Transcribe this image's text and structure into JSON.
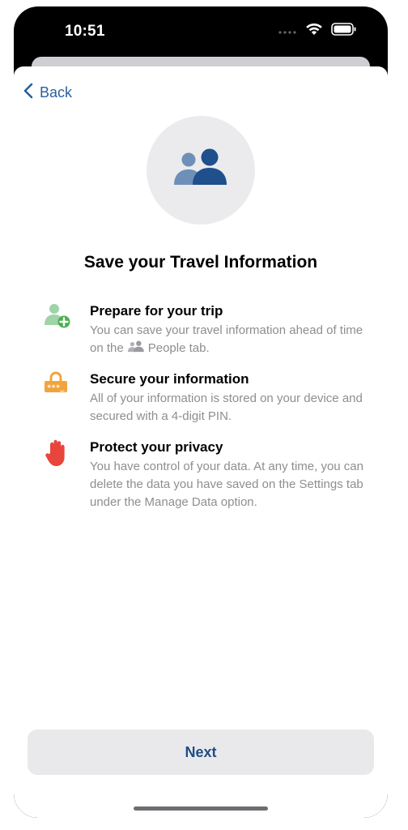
{
  "status_bar": {
    "time": "10:51",
    "signal_icon": "cellular-dots-icon",
    "wifi_icon": "wifi-icon",
    "battery_icon": "battery-icon"
  },
  "nav": {
    "back_label": "Back",
    "back_icon": "chevron-left-icon"
  },
  "hero": {
    "icon": "people-icon",
    "colors": {
      "circle": "#ebebed",
      "front": "#1f4f8c",
      "back": "#6e8fb8"
    }
  },
  "title": "Save your Travel Information",
  "features": [
    {
      "icon": "person-add-icon",
      "heading": "Prepare for your trip",
      "body_before": "You can save your travel information ahead of time on the",
      "inline_icon": "people-icon",
      "body_after": "People tab."
    },
    {
      "icon": "lock-pin-icon",
      "heading": "Secure your information",
      "body": "All of your information is stored on your device and secured with a 4-digit PIN."
    },
    {
      "icon": "raised-hand-icon",
      "heading": "Protect your privacy",
      "body": "You have control of your data. At any time, you can delete the data you have saved on the Settings tab under the Manage Data option."
    }
  ],
  "next_button": {
    "label": "Next"
  },
  "colors": {
    "accent": "#2b5f9e",
    "button_bg": "#e9e9eb",
    "secondary_text": "#8e8e93",
    "green": "#4caf50",
    "orange": "#f2a43a",
    "red": "#e8453c"
  }
}
